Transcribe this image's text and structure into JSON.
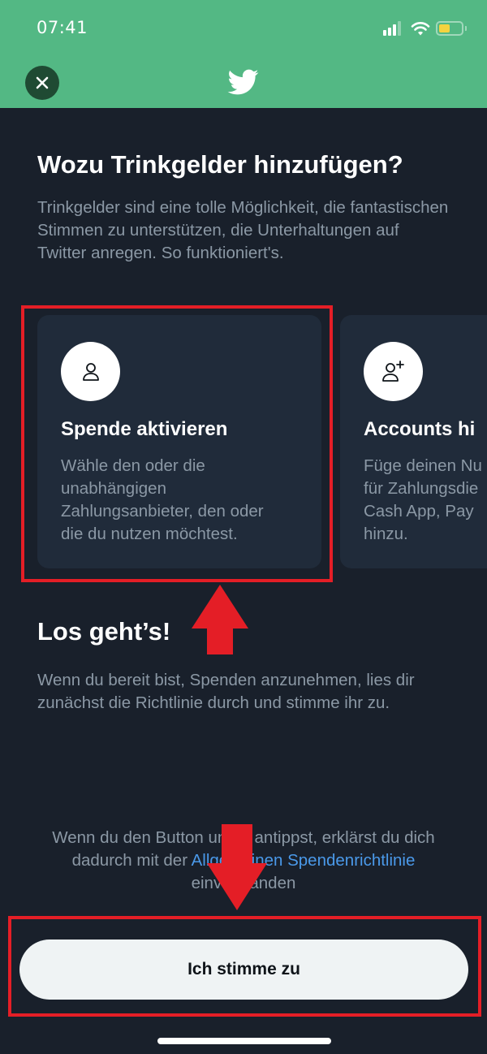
{
  "status_bar": {
    "time": "07:41",
    "icons": [
      "cellular-signal-icon",
      "wifi-icon",
      "battery-icon"
    ],
    "battery_color": "#f4d33f"
  },
  "header": {
    "background_color": "#53b884",
    "close_icon": "close-icon",
    "logo": "twitter-bird-logo"
  },
  "intro": {
    "title": "Wozu Trinkgelder hinzufügen?",
    "text": "Trinkgelder sind eine tolle Möglichkeit, die fantastischen Stimmen zu unterstützen, die Unterhaltungen auf Twitter anregen. So funktioniert's."
  },
  "cards": [
    {
      "icon": "person-icon",
      "title": "Spende aktivieren",
      "description": "Wähle den oder die\nunabhängigen\nZahlungsanbieter, den oder\ndie du nutzen möchtest."
    },
    {
      "icon": "person-add-icon",
      "title": "Accounts hi",
      "description": "Füge deinen Nu\nfür Zahlungsdie\nCash App, Pay\nhinzu."
    }
  ],
  "ready": {
    "title": "Los geht’s!",
    "text": "Wenn du bereit bist, Spenden anzunehmen, lies dir zunächst die Richtlinie durch und stimme ihr zu."
  },
  "terms": {
    "prefix": "Wenn du den Button unten antippst, erklärst du dich dadurch mit der ",
    "link": "Allgemeinen Spendenrichtlinie",
    "suffix": " einverstanden",
    "link_color": "#4a99e9"
  },
  "agree_button": {
    "label": "Ich stimme zu"
  },
  "annotations": {
    "color": "#e41e26"
  }
}
